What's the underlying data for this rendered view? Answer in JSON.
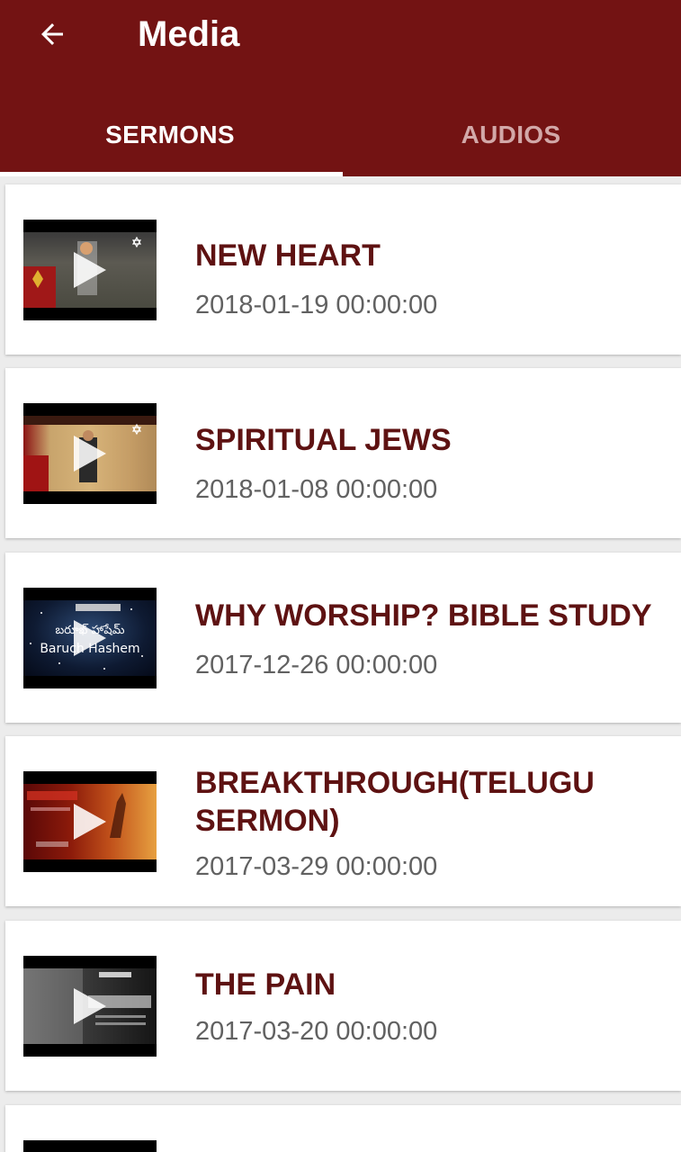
{
  "header": {
    "title": "Media",
    "back_icon": "arrow-left-icon",
    "background": "#731313"
  },
  "tabs": [
    {
      "label": "SERMONS",
      "active": true
    },
    {
      "label": "AUDIOS",
      "active": false
    }
  ],
  "sermons": [
    {
      "title": "NEW HEART",
      "date": "2018-01-19 00:00:00"
    },
    {
      "title": "SPIRITUAL JEWS",
      "date": "2018-01-08 00:00:00"
    },
    {
      "title": "WHY WORSHIP? BIBLE STUDY",
      "date": "2017-12-26 00:00:00",
      "thumb_text": [
        "బరూఖ్ హాషేమ్",
        "Baruch Hashem"
      ]
    },
    {
      "title": "BREAKTHROUGH(TELUGU SERMON)",
      "date": "2017-03-29 00:00:00"
    },
    {
      "title": "THE PAIN",
      "date": "2017-03-20 00:00:00"
    }
  ],
  "colors": {
    "accent": "#731313",
    "title_text": "#5e1212",
    "date_text": "#616161",
    "inactive_tab": "#d2a8a8"
  }
}
